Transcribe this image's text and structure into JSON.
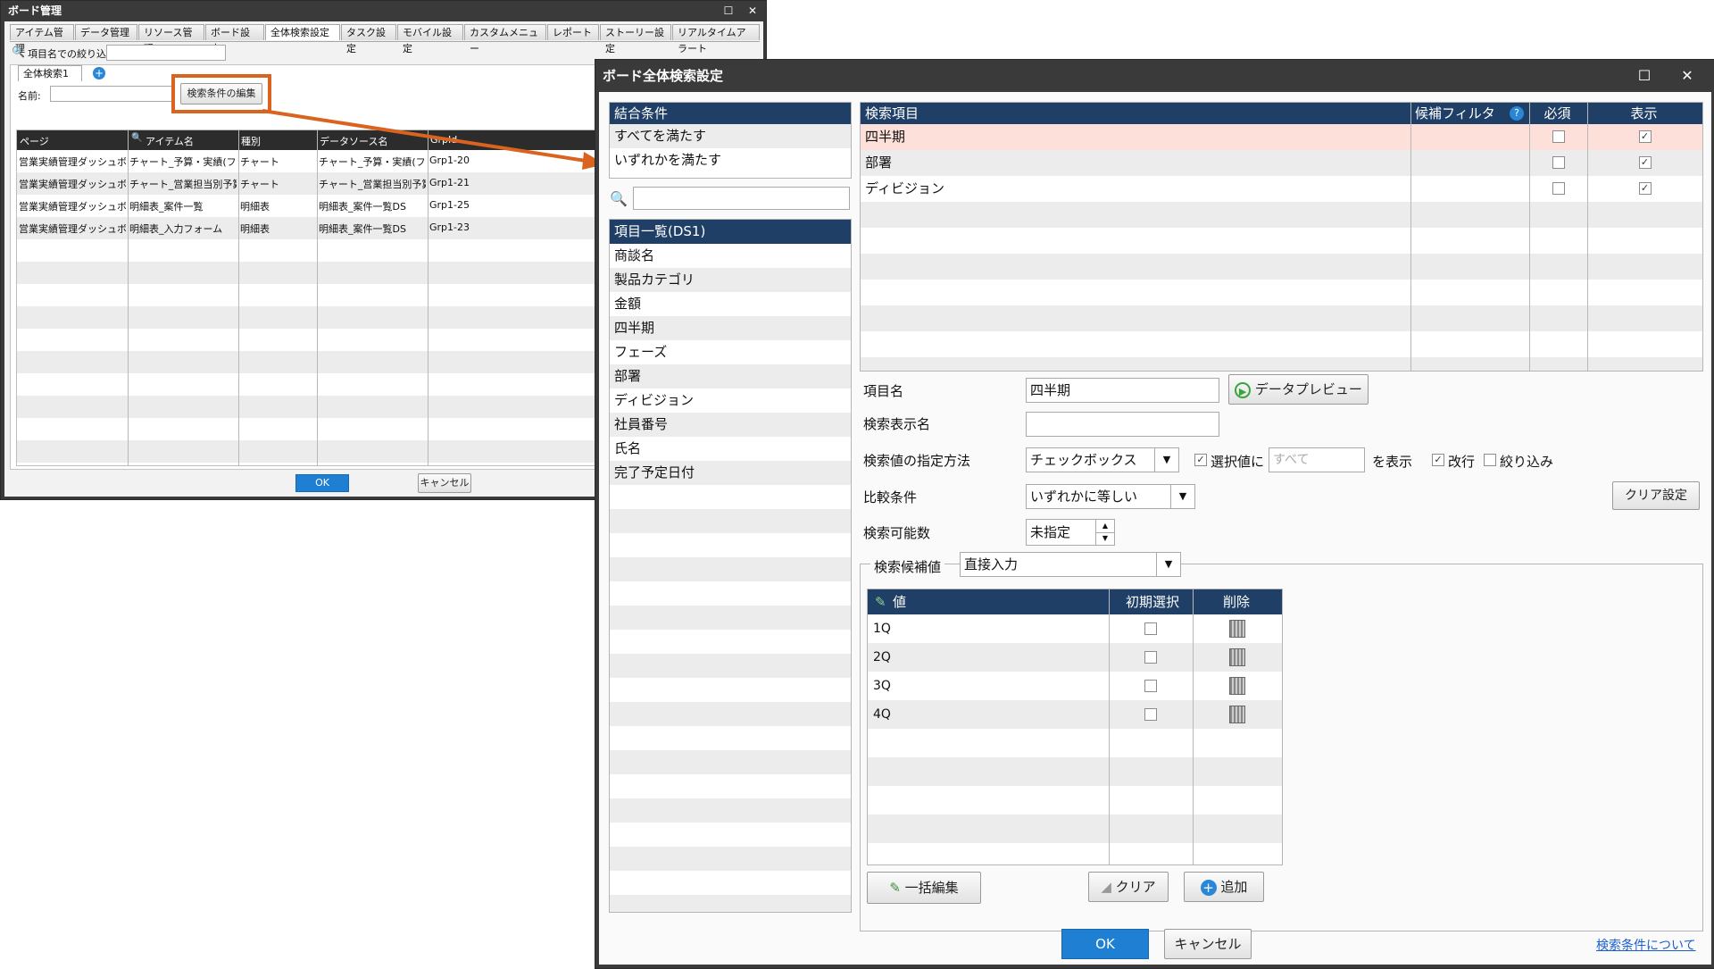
{
  "back_window": {
    "title": "ボード管理",
    "tabs": [
      "アイテム管理",
      "データ管理",
      "リソース管理",
      "ボード設定",
      "全体検索設定",
      "タスク設定",
      "モバイル設定",
      "カスタムメニュー",
      "レポート",
      "ストーリー設定",
      "リアルタイムアラート"
    ],
    "active_tab": 4,
    "filter_label": "項目名での絞り込み",
    "search_tab_label": "全体検索1",
    "name_label": "名前:",
    "edit_button": "検索条件の編集",
    "columns": [
      "ページ",
      "アイテム名",
      "種別",
      "データソース名",
      "GrpId"
    ],
    "rows": [
      [
        "営業実績管理ダッシュボード",
        "チャート_予算・実績(フェーズ別",
        "チャート",
        "チャート_予算・実績(フェーズ別",
        "Grp1-20"
      ],
      [
        "営業実績管理ダッシュボード",
        "チャート_営業担当別予算達",
        "チャート",
        "チャート_営業担当別予算達",
        "Grp1-21"
      ],
      [
        "営業実績管理ダッシュボード",
        "明細表_案件一覧",
        "明細表",
        "明細表_案件一覧DS",
        "Grp1-25"
      ],
      [
        "営業実績管理ダッシュボード",
        "明細表_入力フォーム",
        "明細表",
        "明細表_案件一覧DS",
        "Grp1-23"
      ]
    ],
    "ok_label": "OK",
    "cancel_label": "キャンセル",
    "highlight_color": "#d9631f"
  },
  "dialog": {
    "title": "ボード全体検索設定",
    "join": {
      "header": "結合条件",
      "options": [
        "すべてを満たす",
        "いずれかを満たす"
      ]
    },
    "items_header": "項目一覧(DS1)",
    "items": [
      "商談名",
      "製品カテゴリ",
      "金額",
      "四半期",
      "フェーズ",
      "部署",
      "ディビジョン",
      "社員番号",
      "氏名",
      "完了予定日付"
    ],
    "search_table": {
      "headers": [
        "検索項目",
        "候補フィルタ",
        "必須",
        "表示"
      ],
      "rows": [
        {
          "name": "四半期",
          "required": false,
          "shown": true
        },
        {
          "name": "部署",
          "required": false,
          "shown": true
        },
        {
          "name": "ディビジョン",
          "required": false,
          "shown": true
        }
      ]
    },
    "form": {
      "item_name_label": "項目名",
      "item_name_value": "四半期",
      "preview_button": "データプレビュー",
      "display_name_label": "検索表示名",
      "display_name_value": "",
      "method_label": "検索値の指定方法",
      "method_value": "チェックボックス",
      "select_value_label": "選択値に",
      "select_value_placeholder": "すべて",
      "display_suffix": "を表示",
      "newline_label": "改行",
      "narrow_label": "絞り込み",
      "compare_label": "比較条件",
      "compare_value": "いずれかに等しい",
      "clear_setting_button": "クリア設定",
      "count_label": "検索可能数",
      "count_value": "未指定",
      "candidates_label": "検索候補値",
      "candidates_value": "直接入力"
    },
    "values_table": {
      "headers": [
        "値",
        "初期選択",
        "削除"
      ],
      "rows": [
        "1Q",
        "2Q",
        "3Q",
        "4Q"
      ]
    },
    "bulk_edit_button": "一括編集",
    "clear_button": "クリア",
    "add_button": "追加",
    "ok_label": "OK",
    "cancel_label": "キャンセル",
    "help_link": "検索条件について"
  }
}
